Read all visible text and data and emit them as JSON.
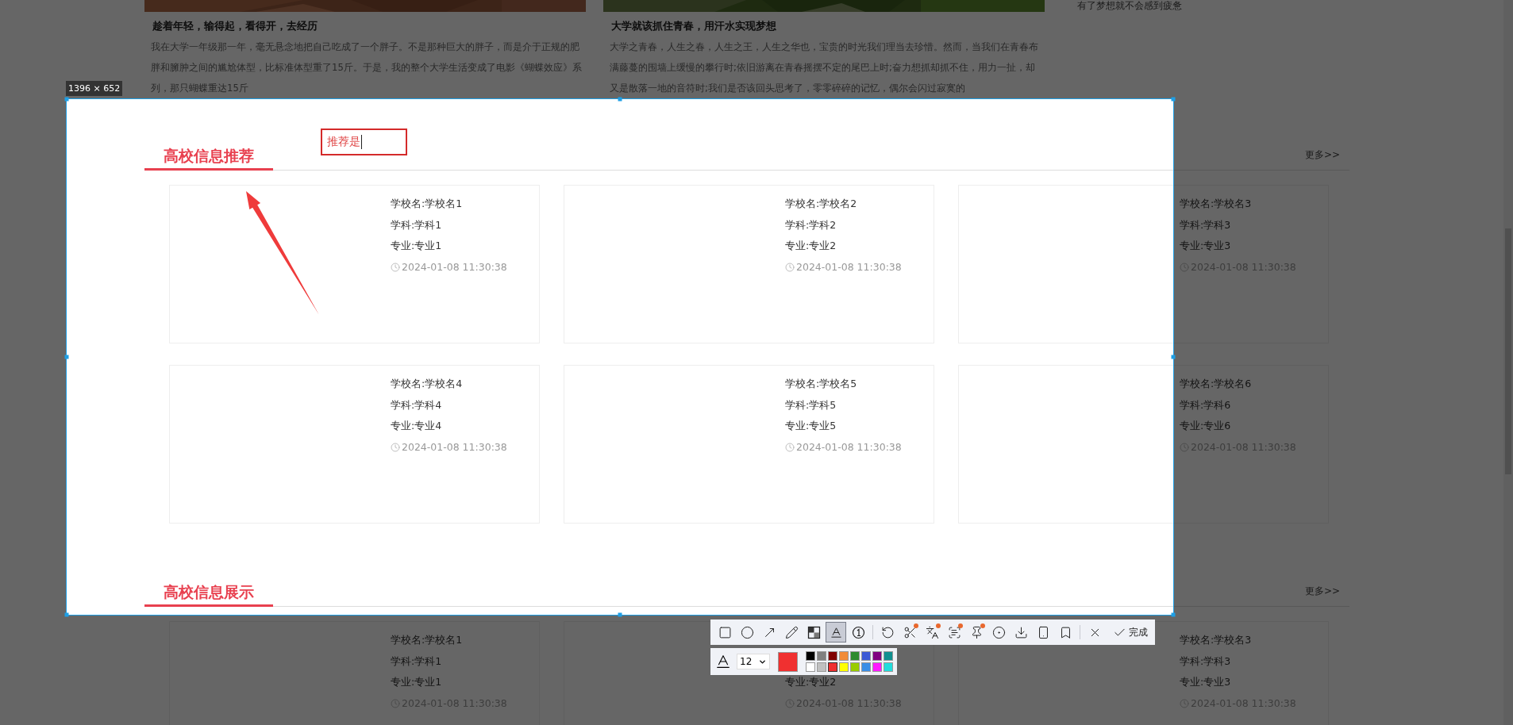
{
  "articles": [
    {
      "title": "趁着年轻，输得起，看得开，去经历",
      "body": "我在大学一年级那一年，毫无悬念地把自己吃成了一个胖子。不是那种巨大的胖子，而是介于正规的肥胖和臃肿之间的尴尬体型，比标准体型重了15斤。于是，我的整个大学生活变成了电影《蝴蝶效应》系列，那只蝴蝶重达15斤"
    },
    {
      "title": "大学就该抓住青春，用汗水实现梦想",
      "body": "大学之青春，人生之春，人生之王，人生之华也，宝贵的时光我们理当去珍惜。然而，当我们在青春布满藤蔓的围墙上缓慢的攀行时;依旧游离在青春摇摆不定的尾巴上时;奋力想抓却抓不住，用力一扯，却又是散落一地的音符时;我们是否该回头思考了，零零碎碎的记忆，偶尔会闪过寂寞的"
    }
  ],
  "sidebar": {
    "items": [
      "有了梦想就不会感到疲惫"
    ]
  },
  "sections": [
    {
      "title": "高校信息推荐",
      "more": "更多>>",
      "cards": [
        {
          "school": "学校名:学校名1",
          "subject": "学科:学科1",
          "major": "专业:专业1",
          "time": "2024-01-08 11:30:38"
        },
        {
          "school": "学校名:学校名2",
          "subject": "学科:学科2",
          "major": "专业:专业2",
          "time": "2024-01-08 11:30:38"
        },
        {
          "school": "学校名:学校名3",
          "subject": "学科:学科3",
          "major": "专业:专业3",
          "time": "2024-01-08 11:30:38"
        },
        {
          "school": "学校名:学校名4",
          "subject": "学科:学科4",
          "major": "专业:专业4",
          "time": "2024-01-08 11:30:38"
        },
        {
          "school": "学校名:学校名5",
          "subject": "学科:学科5",
          "major": "专业:专业5",
          "time": "2024-01-08 11:30:38"
        },
        {
          "school": "学校名:学校名6",
          "subject": "学科:学科6",
          "major": "专业:专业6",
          "time": "2024-01-08 11:30:38"
        }
      ]
    },
    {
      "title": "高校信息展示",
      "more": "更多>>",
      "cards": [
        {
          "school": "学校名:学校名1",
          "subject": "学科:学科1",
          "major": "专业:专业1",
          "time": "2024-01-08 11:30:38"
        },
        {
          "major": "专业:专业2",
          "time": "2024-01-08 11:30:38"
        },
        {
          "school": "学校名:学校名3",
          "subject": "学科:学科3",
          "major": "专业:专业3",
          "time": "2024-01-08 11:30:38"
        }
      ]
    }
  ],
  "capture": {
    "size_label": "1396 × 652",
    "text_note": "推荐是",
    "tools": [
      {
        "kind": "rectangle",
        "selected": false,
        "badge": false
      },
      {
        "kind": "ellipse",
        "selected": false,
        "badge": false
      },
      {
        "kind": "arrow",
        "selected": false,
        "badge": false
      },
      {
        "kind": "pencil",
        "selected": false,
        "badge": false
      },
      {
        "kind": "mosaic",
        "selected": false,
        "badge": false
      },
      {
        "kind": "text",
        "selected": true,
        "badge": false
      },
      {
        "kind": "number",
        "selected": false,
        "badge": false
      },
      {
        "kind": "separator"
      },
      {
        "kind": "undo",
        "selected": false,
        "badge": false
      },
      {
        "kind": "cut",
        "selected": false,
        "badge": true
      },
      {
        "kind": "translate",
        "selected": false,
        "badge": true
      },
      {
        "kind": "ocr",
        "selected": false,
        "badge": true
      },
      {
        "kind": "pin",
        "selected": false,
        "badge": true
      },
      {
        "kind": "record",
        "selected": false,
        "badge": false
      },
      {
        "kind": "download",
        "selected": false,
        "badge": false
      },
      {
        "kind": "phone",
        "selected": false,
        "badge": false
      },
      {
        "kind": "bookmark",
        "selected": false,
        "badge": false
      },
      {
        "kind": "separator"
      },
      {
        "kind": "close",
        "selected": false,
        "badge": false
      },
      {
        "kind": "done",
        "label": "完成"
      }
    ],
    "font_size": "12",
    "palette": [
      {
        "color": "#000000",
        "selected": false
      },
      {
        "color": "#808080",
        "selected": false
      },
      {
        "color": "#800000",
        "selected": false
      },
      {
        "color": "#f28c38",
        "selected": false
      },
      {
        "color": "#2e8b2e",
        "selected": false
      },
      {
        "color": "#3c5ad6",
        "selected": false
      },
      {
        "color": "#800080",
        "selected": false
      },
      {
        "color": "#109090",
        "selected": false
      },
      {
        "color": "#ffffff",
        "selected": false
      },
      {
        "color": "#c0c0c0",
        "selected": false
      },
      {
        "color": "#f03030",
        "selected": true
      },
      {
        "color": "#ffff00",
        "selected": false
      },
      {
        "color": "#99cc00",
        "selected": false
      },
      {
        "color": "#3a8ee6",
        "selected": false
      },
      {
        "color": "#ff1aff",
        "selected": false
      },
      {
        "color": "#22dddd",
        "selected": false
      }
    ]
  }
}
